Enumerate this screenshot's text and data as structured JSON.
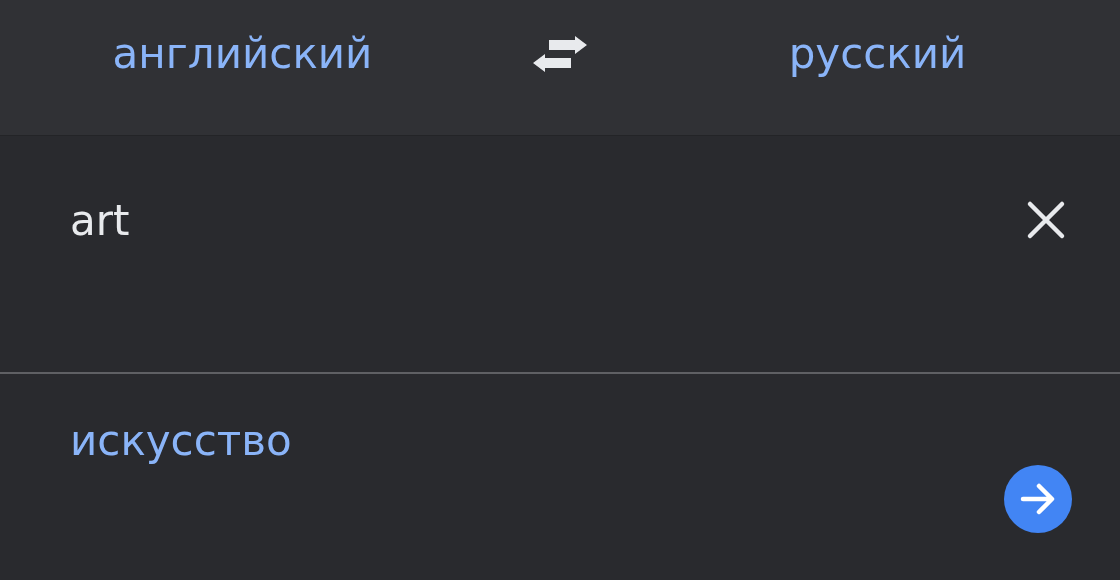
{
  "language_bar": {
    "source_language": "английский",
    "target_language": "русский"
  },
  "input": {
    "value": "art"
  },
  "result": {
    "translation": "искусство"
  }
}
